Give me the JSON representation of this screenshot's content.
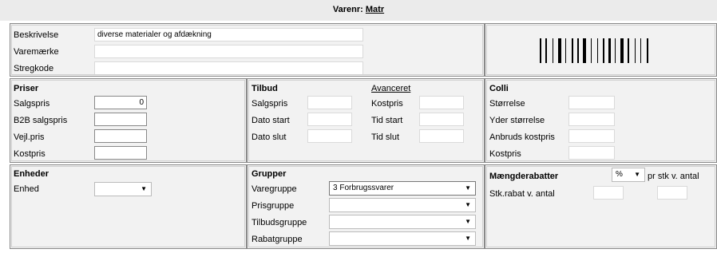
{
  "header": {
    "prefix": "Varenr:",
    "item_no": "Matr"
  },
  "top": {
    "beskrivelse_label": "Beskrivelse",
    "beskrivelse_value": "diverse materialer og afdækning",
    "varemaerke_label": "Varemærke",
    "varemaerke_value": "",
    "stregkode_label": "Stregkode",
    "stregkode_value": ""
  },
  "priser": {
    "title": "Priser",
    "salgspris_label": "Salgspris",
    "salgspris_value": "0",
    "b2b_label": "B2B salgspris",
    "vejl_label": "Vejl.pris",
    "kostpris_label": "Kostpris"
  },
  "tilbud": {
    "title": "Tilbud",
    "advanced_link": "Avanceret",
    "salgspris_label": "Salgspris",
    "kostpris_label": "Kostpris",
    "dato_start_label": "Dato start",
    "tid_start_label": "Tid start",
    "dato_slut_label": "Dato slut",
    "tid_slut_label": "Tid slut"
  },
  "colli": {
    "title": "Colli",
    "stoerrelse_label": "Størrelse",
    "yder_label": "Yder størrelse",
    "anbruds_label": "Anbruds kostpris",
    "kostpris_label": "Kostpris"
  },
  "enheder": {
    "title": "Enheder",
    "enhed_label": "Enhed",
    "enhed_value": ""
  },
  "grupper": {
    "title": "Grupper",
    "varegruppe_label": "Varegruppe",
    "varegruppe_value": "3 Forbrugssvarer",
    "prisgruppe_label": "Prisgruppe",
    "prisgruppe_value": "",
    "tilbudsgruppe_label": "Tilbudsgruppe",
    "tilbudsgruppe_value": "",
    "rabatgruppe_label": "Rabatgruppe",
    "rabatgruppe_value": ""
  },
  "maengde": {
    "title": "Mængderabatter",
    "unit_value": "%",
    "pr_text": "pr stk v. antal",
    "stk_label": "Stk.rabat v. antal"
  },
  "icons": {
    "dropdown": "chevron-down-icon",
    "barcode": "barcode-image"
  }
}
